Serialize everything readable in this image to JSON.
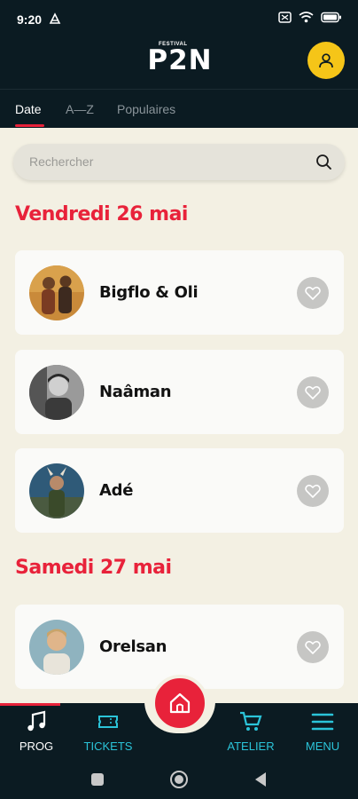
{
  "status": {
    "time": "9:20"
  },
  "header": {
    "logo_small": "FESTIVAL",
    "logo_big": "P2N"
  },
  "tabs": [
    {
      "label": "Date",
      "active": true
    },
    {
      "label": "A—Z",
      "active": false
    },
    {
      "label": "Populaires",
      "active": false
    }
  ],
  "search": {
    "placeholder": "Rechercher"
  },
  "days": [
    {
      "heading": "Vendredi 26 mai",
      "artists": [
        {
          "name": "Bigflo & Oli",
          "favorite": false
        },
        {
          "name": "Naâman",
          "favorite": false
        },
        {
          "name": "Adé",
          "favorite": false
        }
      ]
    },
    {
      "heading": "Samedi 27 mai",
      "artists": [
        {
          "name": "Orelsan",
          "favorite": false
        }
      ]
    }
  ],
  "bottom_nav": {
    "items": [
      {
        "label": "PROG",
        "icon": "music-note-icon",
        "active": true
      },
      {
        "label": "TICKETS",
        "icon": "ticket-icon",
        "active": false
      },
      {
        "label": "ATELIER",
        "icon": "cart-icon",
        "active": false
      },
      {
        "label": "MENU",
        "icon": "menu-icon",
        "active": false
      }
    ],
    "home_icon": "home-icon"
  },
  "colors": {
    "brand_red": "#e8223a",
    "dark_bg": "#0b1b22",
    "page_bg": "#f3f0e3",
    "accent_cyan": "#2bc4d9",
    "profile_yellow": "#f5c518"
  }
}
